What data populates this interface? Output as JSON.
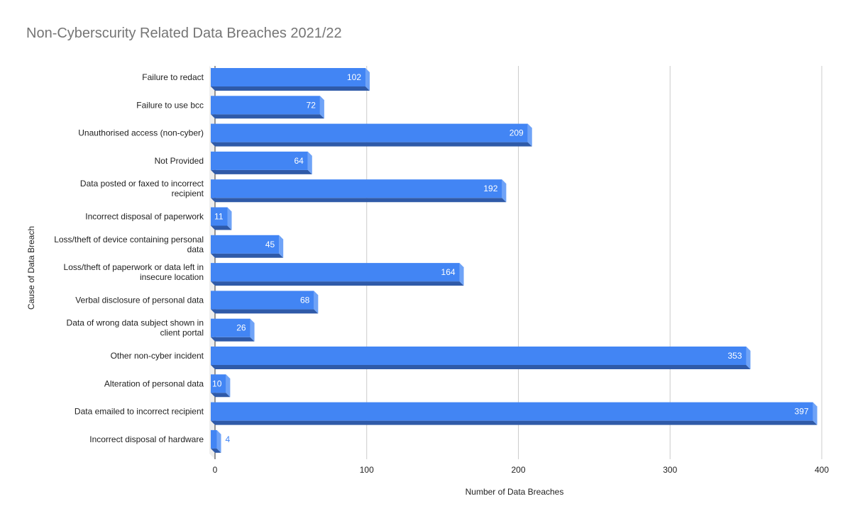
{
  "chart_data": {
    "type": "bar",
    "orientation": "horizontal",
    "style": "3d",
    "title": "Non-Cyberscurity Related Data Breaches 2021/22",
    "xlabel": "Number of Data Breaches",
    "ylabel": "Cause of Data Breach",
    "xlim": [
      0,
      400
    ],
    "xticks": [
      "0",
      "100",
      "200",
      "300",
      "400"
    ],
    "xtick_values": [
      0,
      100,
      200,
      300,
      400
    ],
    "grid": true,
    "legend": "none",
    "colors": {
      "bar": "#4285f4",
      "bar_side": "#6fa3f7",
      "bar_bottom": "#2f5aa8",
      "grid": "#cccccc",
      "label_outside": "#4285f4"
    },
    "categories": [
      [
        "Failure to redact"
      ],
      [
        "Failure to use bcc"
      ],
      [
        "Unauthorised access (non-cyber)"
      ],
      [
        "Not Provided"
      ],
      [
        "Data posted or faxed to incorrect",
        "recipient"
      ],
      [
        "Incorrect disposal of paperwork"
      ],
      [
        "Loss/theft of device containing personal",
        "data"
      ],
      [
        "Loss/theft of paperwork or data left in",
        "insecure location"
      ],
      [
        "Verbal disclosure of personal data"
      ],
      [
        "Data of wrong data subject shown in",
        "client portal"
      ],
      [
        "Other non-cyber incident"
      ],
      [
        "Alteration of personal data"
      ],
      [
        "Data emailed to incorrect recipient"
      ],
      [
        "Incorrect disposal of hardware"
      ]
    ],
    "values": [
      102,
      72,
      209,
      64,
      192,
      11,
      45,
      164,
      68,
      26,
      353,
      10,
      397,
      4
    ]
  }
}
